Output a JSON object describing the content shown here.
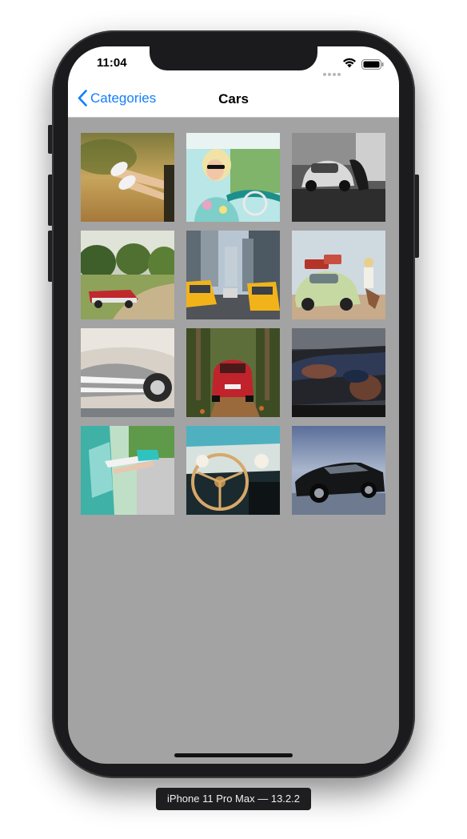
{
  "status_bar": {
    "time": "11:04",
    "icons": [
      "cellular-dots-icon",
      "wifi-icon",
      "battery-icon"
    ]
  },
  "nav": {
    "back_label": "Categories",
    "back_icon": "chevron-left-icon",
    "title": "Cars"
  },
  "colors": {
    "accent": "#147efb",
    "grid_background": "#a3a3a3",
    "nav_background": "#ffffff"
  },
  "photos": [
    {
      "subject": "legs-out-car-window-sneakers"
    },
    {
      "subject": "woman-sunglasses-driving-convertible"
    },
    {
      "subject": "black-white-beetle-couple"
    },
    {
      "subject": "red-vintage-convertible-countryside"
    },
    {
      "subject": "yellow-taxis-city-street"
    },
    {
      "subject": "green-beetle-woman-luggage"
    },
    {
      "subject": "vintage-car-chrome-grille"
    },
    {
      "subject": "red-small-car-forest-road"
    },
    {
      "subject": "people-lying-on-car-hood"
    },
    {
      "subject": "feet-out-teal-car-window"
    },
    {
      "subject": "vintage-dashboard-steering-wheel"
    },
    {
      "subject": "black-muscle-car"
    }
  ],
  "device_label": "iPhone 11 Pro Max — 13.2.2"
}
